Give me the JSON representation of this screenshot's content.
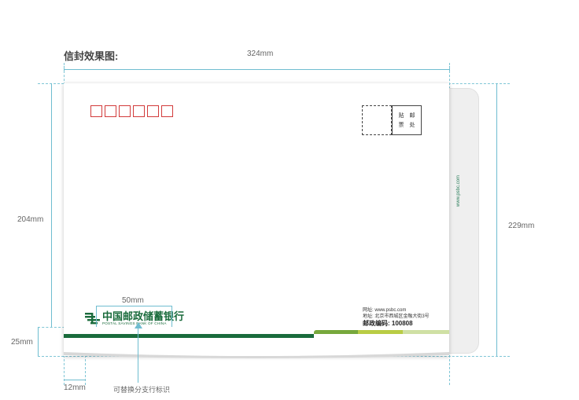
{
  "title": "信封效果图:",
  "dimensions": {
    "width": "324mm",
    "height_inner": "204mm",
    "height_total": "229mm",
    "band": "25mm",
    "left_margin": "12mm",
    "logo_width": "50mm"
  },
  "envelope": {
    "stamp_labels": [
      "贴",
      "邮",
      "票",
      "处"
    ],
    "logo_cn": "中国邮政储蓄银行",
    "logo_en": "POSTAL SAVINGS BANK OF CHINA",
    "website": "网址: www.psbc.com",
    "address": "地址: 北京市西城区金融大街3号",
    "postcode": "邮政编码: 100808",
    "flap_text": "www.psbc.com"
  },
  "note": "可替换分支行标识",
  "colors": {
    "guide": "#6fbdd0",
    "zip_box": "#d23b3b",
    "brand_green": "#1a6b3c",
    "band_light1": "#77a83c",
    "band_light2": "#b9cc45",
    "band_light3": "#cfe0a4"
  }
}
